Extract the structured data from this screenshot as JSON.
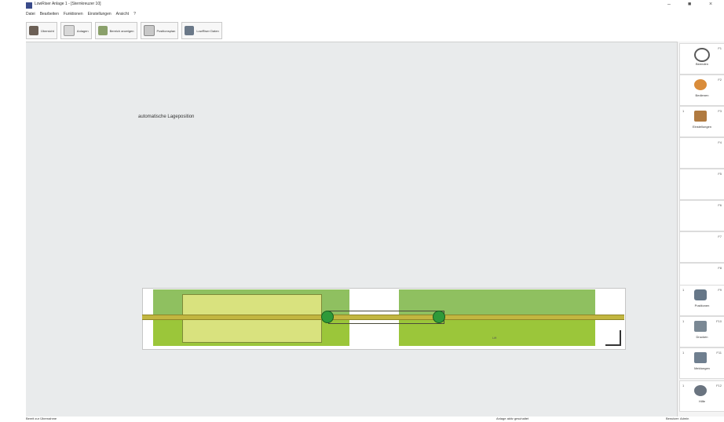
{
  "window": {
    "title": "LowRiser Anlage 1 - [Sternkreuzer 10]",
    "controls": [
      "–",
      "■",
      "×"
    ]
  },
  "menu": [
    "Datei",
    "Bearbeiten",
    "Funktionen",
    "Einstellungen",
    "Ansicht",
    "?"
  ],
  "toolbar": [
    {
      "label": "Übersicht",
      "icon": "overview-icon"
    },
    {
      "label": "Anlagen",
      "icon": "plant-icon"
    },
    {
      "label": "Bereich anzeigen",
      "icon": "area-icon"
    },
    {
      "label": "Positionsplan",
      "icon": "plan-icon"
    },
    {
      "label": "LowRiser Daten",
      "icon": "data-icon"
    }
  ],
  "canvas": {
    "caption": "automatische Lageposition",
    "small_label": "Lift"
  },
  "colors": {
    "green_dark": "#8fc060",
    "green_light": "#9bc63a",
    "yellow_green": "#d9e27e",
    "node": "#2f9a3a"
  },
  "sidebar": [
    {
      "label": "Beenden",
      "fkey": "F1",
      "icon": "power-icon",
      "color": "#5a5a5a",
      "marker": ""
    },
    {
      "label": "Bedienen",
      "fkey": "F2",
      "icon": "operate-icon",
      "color": "#d98c3a",
      "marker": ""
    },
    {
      "label": "Einstellungen",
      "fkey": "F3",
      "icon": "settings-icon",
      "color": "#b07a40",
      "marker": "1"
    },
    {
      "label": "",
      "fkey": "F4",
      "icon": "",
      "color": "",
      "marker": ""
    },
    {
      "label": "",
      "fkey": "F5",
      "icon": "",
      "color": "",
      "marker": ""
    },
    {
      "label": "",
      "fkey": "F6",
      "icon": "",
      "color": "",
      "marker": ""
    },
    {
      "label": "",
      "fkey": "F7",
      "icon": "",
      "color": "",
      "marker": ""
    },
    {
      "label": "",
      "fkey": "F8",
      "icon": "",
      "color": "",
      "marker": ""
    },
    {
      "label": "Positionen",
      "fkey": "F9",
      "icon": "positions-icon",
      "color": "#667788",
      "marker": "1"
    },
    {
      "label": "Drucken",
      "fkey": "F10",
      "icon": "print-icon",
      "color": "#7a8894",
      "marker": "1"
    },
    {
      "label": "Meldungen",
      "fkey": "F11",
      "icon": "messages-icon",
      "color": "#6f7f8f",
      "marker": "1"
    },
    {
      "label": "Hilfe",
      "fkey": "F12",
      "icon": "help-icon",
      "color": "#6a7480",
      "marker": "1"
    }
  ],
  "status": {
    "left": "Bereit zur Übernahme",
    "middle": "Anlage aktiv geschaltet",
    "right": "Benutzer: Admin"
  }
}
